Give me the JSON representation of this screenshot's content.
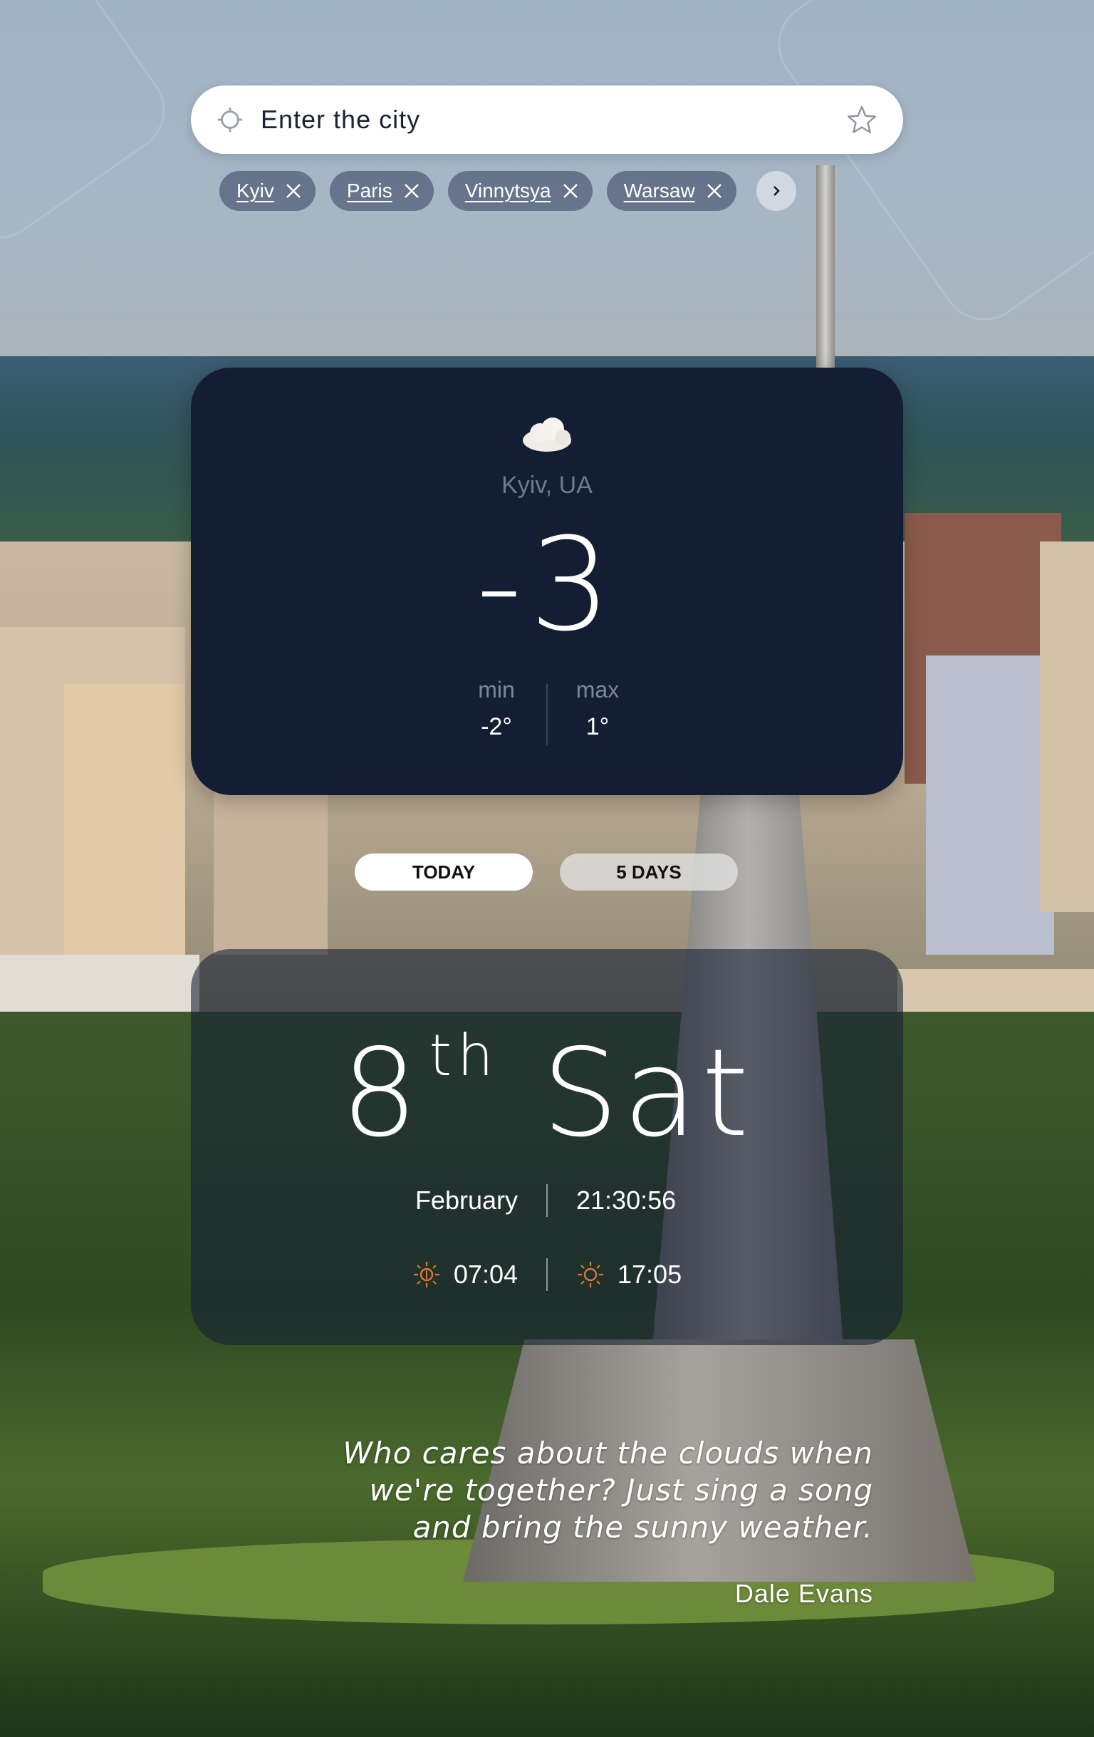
{
  "search": {
    "placeholder": "Enter the city"
  },
  "favorites": [
    {
      "label": "Kyiv"
    },
    {
      "label": "Paris"
    },
    {
      "label": "Vinnytsya"
    },
    {
      "label": "Warsaw"
    }
  ],
  "icons": {
    "locate": "crosshair-icon",
    "favorite": "star-outline-icon",
    "remove": "close-icon",
    "next": "chevron-right-icon",
    "weather": "cloud-icon",
    "sunrise": "sunrise-icon",
    "sunset": "sunset-icon"
  },
  "weather": {
    "city": "Kyiv, UA",
    "temperature": "-3",
    "min_label": "min",
    "min_value": "-2°",
    "max_label": "max",
    "max_value": "1°"
  },
  "tabs": [
    {
      "label": "TODAY",
      "active": true
    },
    {
      "label": "5 DAYS",
      "active": false
    }
  ],
  "date": {
    "day": "8",
    "suffix": "th",
    "weekday": "Sat",
    "month": "February",
    "time": "21:30:56",
    "sunrise": "07:04",
    "sunset": "17:05"
  },
  "quote": {
    "text": "Who cares about the clouds when we're together? Just sing a song and bring the sunny weather.",
    "author": "Dale Evans"
  },
  "colors": {
    "card_dark": "#131e34",
    "sun_icon": "#e0772b",
    "chip_bg": "#505f78"
  }
}
